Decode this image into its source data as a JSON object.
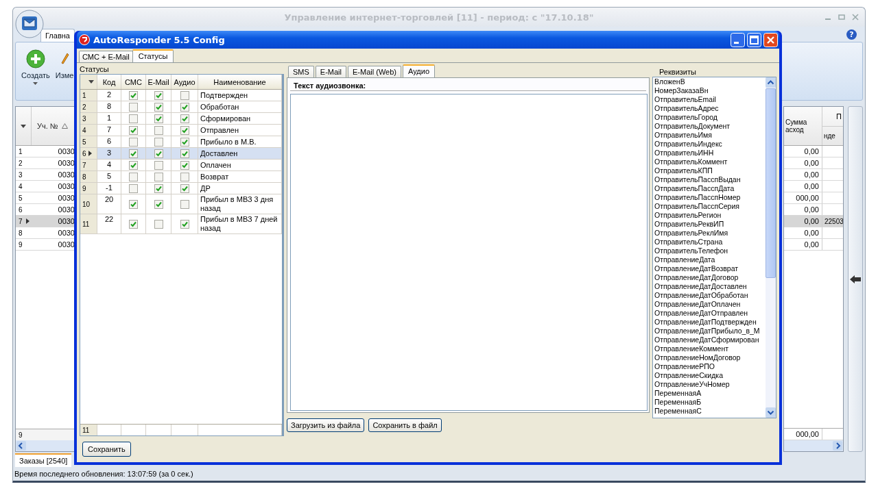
{
  "window": {
    "title": "Управление интернет-торговлей [11] - период: с \"17.10.18\"",
    "help": "?"
  },
  "ribbon": {
    "tab": "Главна",
    "buttons": [
      {
        "label": "Создать",
        "kind": "create"
      },
      {
        "label": "Изме",
        "kind": "edit"
      }
    ]
  },
  "orders": {
    "column": "Уч. №",
    "rows": [
      {
        "num": "1",
        "id": "0030",
        "sum": "0,00",
        "selected": false
      },
      {
        "num": "2",
        "id": "0030",
        "sum": "0,00",
        "selected": false
      },
      {
        "num": "3",
        "id": "0030",
        "sum": "0,00",
        "selected": false
      },
      {
        "num": "4",
        "id": "0030",
        "sum": "0,00",
        "selected": false
      },
      {
        "num": "5",
        "id": "0030",
        "sum": "000,00",
        "selected": false
      },
      {
        "num": "6",
        "id": "0030",
        "sum": "0,00",
        "selected": false
      },
      {
        "num": "7",
        "id": "0030",
        "sum": "0,00",
        "extra": "22503",
        "selected": true
      },
      {
        "num": "8",
        "id": "0030",
        "sum": "0,00",
        "selected": false
      },
      {
        "num": "9",
        "id": "0030",
        "sum": "0,00",
        "selected": false
      }
    ],
    "footer": "9",
    "sum_header": [
      "Сумма",
      "асход"
    ],
    "group_header": "П",
    "sub_header": "нде",
    "sum_footer": "000,00"
  },
  "bottom_tabs": [
    {
      "label": "Заказы [2540]",
      "selected": true
    }
  ],
  "status_bar": "Время последнего обновления: 13:07:59 (за 0 сек.)",
  "dialog": {
    "title": "AutoResponder 5.5 Config",
    "tabs": [
      {
        "label": "СМС + E-Mail",
        "selected": false
      },
      {
        "label": "Статусы",
        "selected": true
      }
    ],
    "statuses": {
      "label": "Статусы",
      "columns": [
        "Код",
        "СМС",
        "E-Mail",
        "Аудио",
        "Наименование"
      ],
      "rows": [
        {
          "num": "1",
          "code": "2",
          "sms": true,
          "email": true,
          "audio": false,
          "name": "Подтвержден",
          "selected": false
        },
        {
          "num": "2",
          "code": "8",
          "sms": false,
          "email": true,
          "audio": true,
          "name": "Обработан",
          "selected": false
        },
        {
          "num": "3",
          "code": "1",
          "sms": false,
          "email": true,
          "audio": true,
          "name": "Сформирован",
          "selected": false
        },
        {
          "num": "4",
          "code": "7",
          "sms": true,
          "email": false,
          "audio": true,
          "name": "Отправлен",
          "selected": false
        },
        {
          "num": "5",
          "code": "6",
          "sms": false,
          "email": false,
          "audio": true,
          "name": "Прибыло в М.В.",
          "selected": false
        },
        {
          "num": "6",
          "code": "3",
          "sms": true,
          "email": true,
          "audio": true,
          "name": "Доставлен",
          "selected": true
        },
        {
          "num": "7",
          "code": "4",
          "sms": true,
          "email": false,
          "audio": true,
          "name": "Оплачен",
          "selected": false
        },
        {
          "num": "8",
          "code": "5",
          "sms": false,
          "email": false,
          "audio": false,
          "name": "Возврат",
          "selected": false
        },
        {
          "num": "9",
          "code": "-1",
          "sms": false,
          "email": true,
          "audio": true,
          "name": "ДР",
          "selected": false
        },
        {
          "num": "10",
          "code": "20",
          "sms": true,
          "email": true,
          "audio": false,
          "name": "Прибыл в МВЗ 3 дня назад",
          "selected": false
        },
        {
          "num": "11",
          "code": "22",
          "sms": true,
          "email": false,
          "audio": true,
          "name": "Прибыл в МВЗ 7 дней назад",
          "selected": false
        }
      ],
      "footer": "11"
    },
    "message_tabs": [
      {
        "label": "SMS",
        "selected": false
      },
      {
        "label": "E-Mail",
        "selected": false
      },
      {
        "label": "E-Mail (Web)",
        "selected": false
      },
      {
        "label": "Аудио",
        "selected": true
      }
    ],
    "text_label": "Текст аудиозвонка:",
    "file_buttons": [
      "Загрузить из файла",
      "Сохранить в файл"
    ],
    "fields_label": "Реквизиты",
    "fields": [
      "ВложенВ",
      "НомерЗаказаВн",
      "ОтправительEmail",
      "ОтправительАдрес",
      "ОтправительГород",
      "ОтправительДокумент",
      "ОтправительИмя",
      "ОтправительИндекс",
      "ОтправительИНН",
      "ОтправительКоммент",
      "ОтправительКПП",
      "ОтправительПасспВыдан",
      "ОтправительПасспДата",
      "ОтправительПасспНомер",
      "ОтправительПасспСерия",
      "ОтправительРегион",
      "ОтправительРеквИП",
      "ОтправительРеклИмя",
      "ОтправительСтрана",
      "ОтправительТелефон",
      "ОтправлениеДата",
      "ОтправлениеДатВозврат",
      "ОтправлениеДатДоговор",
      "ОтправлениеДатДоставлен",
      "ОтправлениеДатОбработан",
      "ОтправлениеДатОплачен",
      "ОтправлениеДатОтправлен",
      "ОтправлениеДатПодтвержден",
      "ОтправлениеДатПрибыло_в_М",
      "ОтправлениеДатСформирован",
      "ОтправлениеКоммент",
      "ОтправлениеНомДоговор",
      "ОтправлениеРПО",
      "ОтправлениеСкидка",
      "ОтправлениеУчНомер",
      "ПеременнаяА",
      "ПеременнаяБ",
      "ПеременнаяС"
    ],
    "save_button": "Сохранить"
  }
}
